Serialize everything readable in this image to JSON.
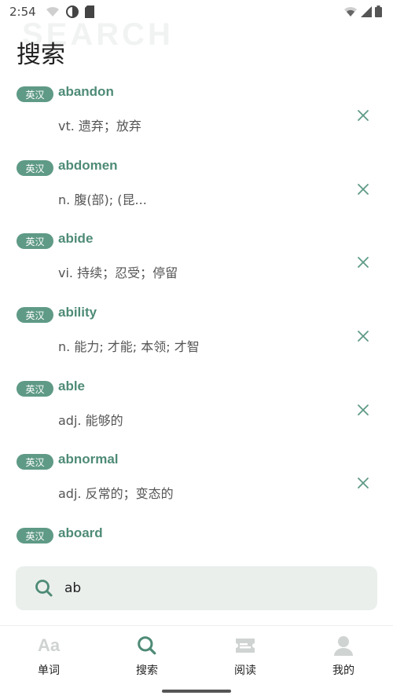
{
  "status_bar": {
    "time": "2:54",
    "icons_left": [
      "wifi-icon",
      "data-saver-icon",
      "sim-card-icon"
    ],
    "icons_right": [
      "wifi-icon",
      "signal-icon",
      "battery-icon"
    ]
  },
  "header": {
    "watermark": "SEARCH",
    "title": "搜索"
  },
  "word_list": [
    {
      "badge": "英汉",
      "word": "abandon",
      "definition": "vt. 遗弃；放弃"
    },
    {
      "badge": "英汉",
      "word": "abdomen",
      "definition": "n. 腹(部); (昆..."
    },
    {
      "badge": "英汉",
      "word": "abide",
      "definition": "vi. 持续；忍受；停留"
    },
    {
      "badge": "英汉",
      "word": "ability",
      "definition": "n. 能力; 才能; 本领; 才智"
    },
    {
      "badge": "英汉",
      "word": "able",
      "definition": "adj. 能够的"
    },
    {
      "badge": "英汉",
      "word": "abnormal",
      "definition": "adj. 反常的；变态的"
    },
    {
      "badge": "英汉",
      "word": "aboard",
      "definition": ""
    }
  ],
  "search": {
    "value": "ab",
    "icon": "search-icon"
  },
  "bottom_nav": {
    "items": [
      {
        "label": "单词",
        "icon": "Aa",
        "active": false
      },
      {
        "label": "搜索",
        "icon": "search-icon",
        "active": true
      },
      {
        "label": "阅读",
        "icon": "ticket-icon",
        "active": false
      },
      {
        "label": "我的",
        "icon": "person-icon",
        "active": false
      }
    ]
  },
  "colors": {
    "accent": "#4e8b76",
    "badge_bg": "#5f9a86",
    "search_bg": "#eaefec",
    "inactive_icon": "#cfd3d1"
  }
}
